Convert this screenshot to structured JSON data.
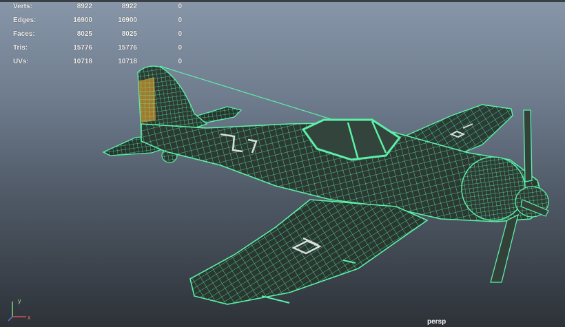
{
  "viewport": {
    "camera_name": "persp",
    "accent_wire_color": "#5cf0a8",
    "selection_color": "#c08a2c"
  },
  "heads_up_display": {
    "rows": [
      {
        "label": "Verts:",
        "c1": "8922",
        "c2": "8922",
        "c3": "0"
      },
      {
        "label": "Edges:",
        "c1": "16900",
        "c2": "16900",
        "c3": "0"
      },
      {
        "label": "Faces:",
        "c1": "8025",
        "c2": "8025",
        "c3": "0"
      },
      {
        "label": "Tris:",
        "c1": "15776",
        "c2": "15776",
        "c3": "0"
      },
      {
        "label": "UVs:",
        "c1": "10718",
        "c2": "10718",
        "c3": "0"
      }
    ]
  },
  "axis_gizmo": {
    "y_label": "y",
    "x_label": "x",
    "icon": "axis-gizmo-icon"
  },
  "model": {
    "icon": "airplane-wireframe-icon"
  }
}
